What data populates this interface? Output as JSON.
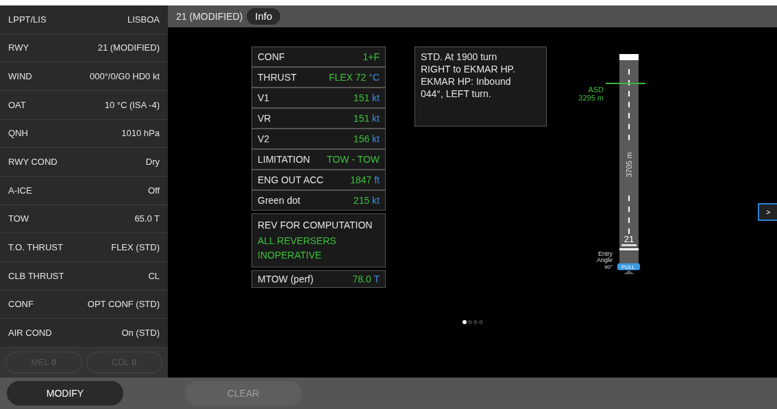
{
  "sidebar": {
    "rows": [
      {
        "label": "LPPT/LIS",
        "value": "LISBOA"
      },
      {
        "label": "RWY",
        "value": "21 (MODIFIED)"
      },
      {
        "label": "WIND",
        "value": "000°/0/G0 HD0 kt"
      },
      {
        "label": "OAT",
        "value": "10 °C (ISA -4)"
      },
      {
        "label": "QNH",
        "value": "1010 hPa"
      },
      {
        "label": "RWY COND",
        "value": "Dry"
      },
      {
        "label": "A-ICE",
        "value": "Off"
      },
      {
        "label": "TOW",
        "value": "65.0 T"
      },
      {
        "label": "T.O. THRUST",
        "value": "FLEX (STD)"
      },
      {
        "label": "CLB THRUST",
        "value": "CL"
      },
      {
        "label": "CONF",
        "value": "OPT CONF (STD)"
      },
      {
        "label": "AIR COND",
        "value": "On (STD)"
      }
    ],
    "buttons": [
      {
        "label": "MEL **0**",
        "disabled": true
      },
      {
        "label": "CDL **0**",
        "disabled": true
      }
    ]
  },
  "header": {
    "title": "21 (MODIFIED)",
    "tab": "Info"
  },
  "results": [
    {
      "label": "CONF",
      "value": "1+F"
    },
    {
      "label": "THRUST",
      "value": "FLEX 72",
      "unit": "°C"
    },
    {
      "label": "V1",
      "value": "151",
      "unit": "kt"
    },
    {
      "label": "VR",
      "value": "151",
      "unit": "kt"
    },
    {
      "label": "V2",
      "value": "156",
      "unit": "kt"
    },
    {
      "label": "LIMITATION",
      "value": "TOW - TOW"
    },
    {
      "label": "ENG OUT ACC",
      "value": "1847",
      "unit": "ft"
    },
    {
      "label": "Green dot",
      "value": "215",
      "unit": "kt"
    }
  ],
  "reversers": {
    "label": "REV FOR COMPUTATION",
    "value": "ALL REVERSERS INOPERATIVE"
  },
  "mtow": {
    "label": "MTOW (perf)",
    "value": "78.0",
    "unit": "T"
  },
  "note": "STD. At 1900 turn RIGHT to EKMAR HP. EKMAR HP: Inbound 044°, LEFT turn.",
  "runway": {
    "asd_label": "ASD",
    "asd_distance": "3295 m",
    "length": "3705 m",
    "number": "21",
    "entry_label": "Entry Angle",
    "entry_angle": "90°",
    "entry_badge": "FULL"
  },
  "pages": [
    {
      "selected": true
    },
    {
      "selected": false
    },
    {
      "selected": false
    },
    {
      "selected": false
    }
  ],
  "next_button": ">",
  "footer": [
    {
      "label": "MODIFY",
      "disabled": false
    },
    {
      "label": "CLEAR",
      "disabled": true
    }
  ]
}
